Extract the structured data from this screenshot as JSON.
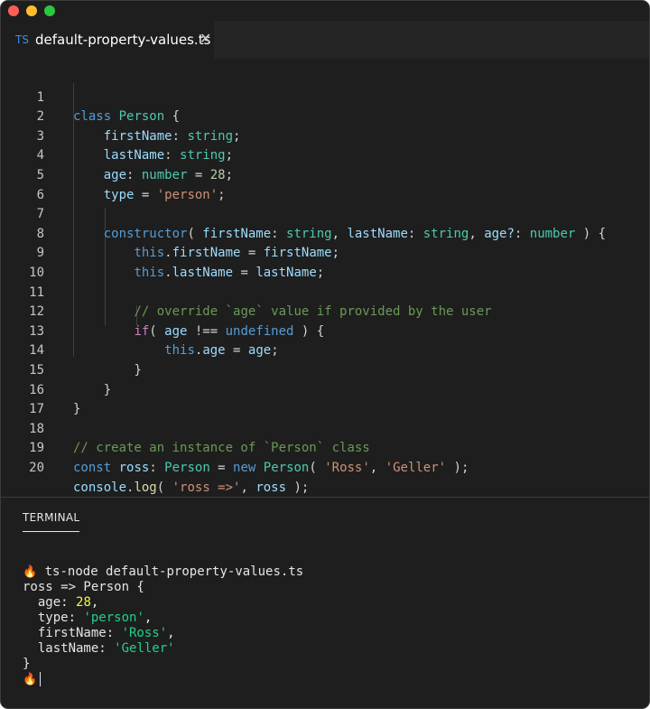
{
  "window": {
    "traffic_lights": [
      "close",
      "minimize",
      "zoom"
    ]
  },
  "tab": {
    "icon_text": "TS",
    "filename": "default-property-values.ts",
    "close_glyph": "✕"
  },
  "editor": {
    "line_numbers": [
      "1",
      "2",
      "3",
      "4",
      "5",
      "6",
      "7",
      "8",
      "9",
      "10",
      "11",
      "12",
      "13",
      "14",
      "15",
      "16",
      "17",
      "18",
      "19",
      "20"
    ],
    "code": {
      "l1": [
        "class",
        "Person",
        "{"
      ],
      "l2": [
        "firstName",
        ": ",
        "string",
        ";"
      ],
      "l3": [
        "lastName",
        ": ",
        "string",
        ";"
      ],
      "l4": [
        "age",
        ": ",
        "number",
        " = ",
        "28",
        ";"
      ],
      "l5": [
        "type",
        " = ",
        "'person'",
        ";"
      ],
      "l7": [
        "constructor",
        "( ",
        "firstName",
        ": ",
        "string",
        ", ",
        "lastName",
        ": ",
        "string",
        ", ",
        "age?",
        ": ",
        "number",
        " ) {"
      ],
      "l8": [
        "this",
        ".",
        "firstName",
        " = ",
        "firstName",
        ";"
      ],
      "l9": [
        "this",
        ".",
        "lastName",
        " = ",
        "lastName",
        ";"
      ],
      "l11": "// override `age` value if provided by the user",
      "l12": [
        "if",
        "( ",
        "age",
        " !== ",
        "undefined",
        " ) {"
      ],
      "l13": [
        "this",
        ".",
        "age",
        " = ",
        "age",
        ";"
      ],
      "l14": "}",
      "l15": "}",
      "l16": "}",
      "l18": "// create an instance of `Person` class",
      "l19": [
        "const",
        "ross",
        ": ",
        "Person",
        " = ",
        "new",
        "Person",
        "( ",
        "'Ross'",
        ", ",
        "'Geller'",
        " );"
      ],
      "l20": [
        "console",
        ".",
        "log",
        "( ",
        "'ross =>'",
        ", ",
        "ross",
        " );"
      ]
    }
  },
  "panel": {
    "title": "TERMINAL",
    "prompt_icon": "🔥",
    "command": "ts-node default-property-values.ts",
    "output": {
      "head": "ross => Person {",
      "age_key": "age: ",
      "age_val": "28",
      "type_key": "type: ",
      "type_val": "'person'",
      "first_key": "firstName: ",
      "first_val": "'Ross'",
      "last_key": "lastName: ",
      "last_val": "'Geller'",
      "close": "}"
    }
  },
  "colors": {
    "background": "#1e1e1e",
    "keyword": "#569cd6",
    "class": "#4ec9b0",
    "property": "#9cdcfe",
    "string": "#ce9178",
    "number": "#b5cea8",
    "comment": "#6a9955",
    "control": "#c586c0",
    "terminal_number": "#f5f543",
    "terminal_string": "#23d18b"
  }
}
